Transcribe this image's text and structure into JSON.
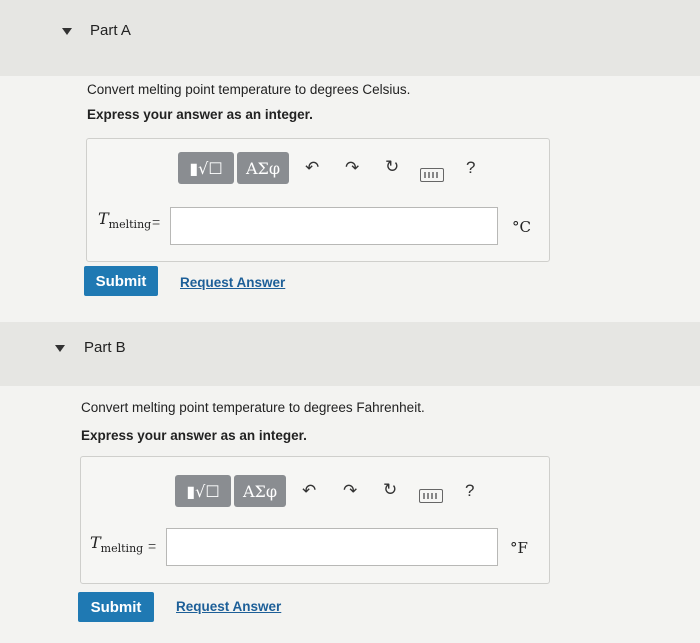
{
  "partA": {
    "title": "Part A",
    "prompt": "Convert melting point temperature to degrees Celsius.",
    "instruction": "Express your answer as an integer.",
    "toolbar": {
      "templates": "▮√☐",
      "greek": "ΑΣφ",
      "help": "?"
    },
    "variable": "T",
    "subscript": "melting",
    "equals": "=",
    "input_value": "",
    "unit": "°C",
    "submit_label": "Submit",
    "request_label": "Request Answer"
  },
  "partB": {
    "title": "Part B",
    "prompt": "Convert melting point temperature to degrees Fahrenheit.",
    "instruction": "Express your answer as an integer.",
    "toolbar": {
      "templates": "▮√☐",
      "greek": "ΑΣφ",
      "help": "?"
    },
    "variable": "T",
    "subscript": "melting",
    "equals": "=",
    "input_value": "",
    "unit": "°F",
    "submit_label": "Submit",
    "request_label": "Request Answer"
  }
}
